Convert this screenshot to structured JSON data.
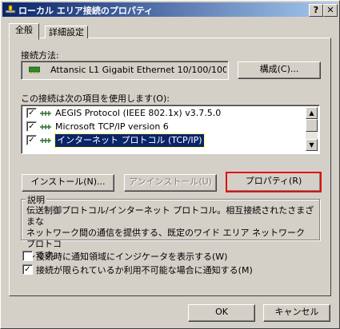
{
  "window": {
    "title": "ローカル エリア接続のプロパティ",
    "help_button": "?",
    "close_button": "✕"
  },
  "tabs": [
    {
      "label": "全般",
      "active": true
    },
    {
      "label": "詳細設定",
      "active": false
    }
  ],
  "connect_using": {
    "label": "接続方法:",
    "adapter_name": "Attansic L1 Gigabit Ethernet 10/100/100",
    "configure_button": "構成(C)..."
  },
  "components": {
    "label": "この接続は次の項目を使用します(O):",
    "items": [
      {
        "label": "AEGIS Protocol (IEEE 802.1x) v3.7.5.0",
        "checked": true,
        "selected": false
      },
      {
        "label": "Microsoft TCP/IP version 6",
        "checked": true,
        "selected": false
      },
      {
        "label": "インターネット プロトコル (TCP/IP)",
        "checked": true,
        "selected": true
      }
    ]
  },
  "actions": {
    "install_button": "インストール(N)...",
    "uninstall_button": "アンインストール(U)",
    "properties_button": "プロパティ(R)"
  },
  "description": {
    "group_title": "説明",
    "text": "伝送制御プロトコル/インターネット プロトコル。相互接続されたさまざまな\nネットワーク間の通信を提供する、既定のワイド エリア ネットワーク プロトコ\nルです。"
  },
  "options": [
    {
      "label": "接続時に通知領域にインジケータを表示する(W)",
      "checked": false
    },
    {
      "label": "接続が限られているか利用不可能な場合に通知する(M)",
      "checked": true
    }
  ],
  "footer": {
    "ok_button": "OK",
    "cancel_button": "キャンセル"
  },
  "colors": {
    "titlebar_start": "#0a246a",
    "titlebar_end": "#a6caf0",
    "selection": "#0a246a",
    "focus_highlight": "#e01010",
    "window_face": "#d4d0c8"
  }
}
